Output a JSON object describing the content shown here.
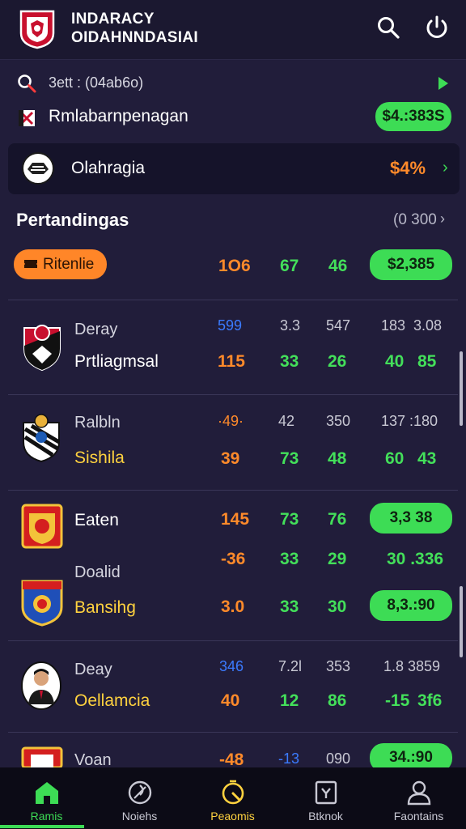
{
  "header": {
    "brand_line1": "INDARACY",
    "brand_line2": "OIDAHNNDASIAI",
    "icons": [
      "club-logo",
      "search-icon",
      "power-icon"
    ]
  },
  "search": {
    "text": "3ett : (04ab6o)"
  },
  "promo": {
    "label": "Rmlabarnpenagan",
    "value": "$4.:383S"
  },
  "banner": {
    "label": "Olahragia",
    "value": "$4%",
    "chevron": "›"
  },
  "section": {
    "title": "Pertandingas",
    "count": "(0 300",
    "chevron": "›"
  },
  "filter": {
    "pill_label": "Ritenlie",
    "values": [
      "1O6",
      "67",
      "46"
    ],
    "pill_value": "$2,385"
  },
  "matches": [
    {
      "team1": "Deray",
      "team2": "Prtliagmsal",
      "row1": [
        "599",
        "3.3",
        "547",
        "183",
        "3.08"
      ],
      "row2": [
        "115",
        "33",
        "26",
        "40",
        "85"
      ]
    },
    {
      "team1": "Ralbln",
      "team2": "Sishila",
      "row1": [
        "·49·",
        "42",
        "350",
        "137 :180"
      ],
      "row2": [
        "39",
        "73",
        "48",
        "60",
        "43"
      ]
    },
    {
      "team1": "Eaten",
      "row1": [
        "145",
        "73",
        "76"
      ],
      "pill1": "3,3 38",
      "row2": [
        "-36",
        "33",
        "29",
        "30 .336"
      ]
    },
    {
      "team1": "Doalid",
      "team2": "Bansihg",
      "row": [
        "3.0",
        "33",
        "30"
      ],
      "pill": "8,3.:90"
    },
    {
      "team1": "Deay",
      "team2": "Oellamcia",
      "row1": [
        "346",
        "7.2l",
        "353",
        "1.8 3859"
      ],
      "row2": [
        "40",
        "12",
        "86",
        "-15",
        "3f6"
      ]
    },
    {
      "team1": "Voan",
      "row": [
        "-48",
        "-13",
        "090"
      ],
      "pill": "34.:90"
    }
  ],
  "nav": [
    {
      "label": "Ramis",
      "icon": "home-icon",
      "active": true
    },
    {
      "label": "Noiehs",
      "icon": "ball-icon"
    },
    {
      "label": "Peaomis",
      "icon": "stopwatch-icon",
      "highlight": true
    },
    {
      "label": "Btknok",
      "icon": "bookmark-icon"
    },
    {
      "label": "Faontains",
      "icon": "user-icon"
    }
  ],
  "colors": {
    "background": "#211d3a",
    "accent_green": "#3ddc55",
    "accent_orange": "#ff8a2a",
    "highlight_yellow": "#ffd23f"
  }
}
